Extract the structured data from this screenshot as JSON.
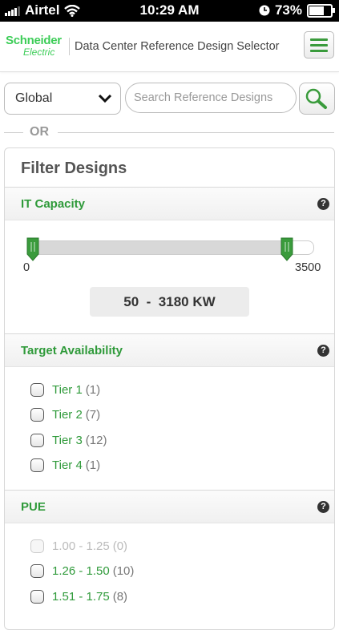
{
  "status": {
    "carrier": "Airtel",
    "time": "10:29 AM",
    "battery": "73%",
    "battery_level": 0.73
  },
  "header": {
    "logo_line1": "Schneider",
    "logo_line2": "Electric",
    "title": "Data Center Reference Design Selector",
    "menu_icon": "hamburger-icon"
  },
  "search": {
    "region": "Global",
    "placeholder": "Search Reference Designs",
    "search_icon": "magnifier-icon"
  },
  "or_label": "OR",
  "filter": {
    "title": "Filter Designs",
    "it_capacity": {
      "label": "IT Capacity",
      "help": "?",
      "min_label": "0",
      "max_label": "3500",
      "range_min": 0,
      "range_max": 3500,
      "low": 50,
      "high": 3180,
      "low_text": "50",
      "separator": "-",
      "high_text": "3180",
      "unit": "KW"
    },
    "target_availability": {
      "label": "Target Availability",
      "help": "?",
      "options": [
        {
          "label": "Tier 1",
          "count": "(1)"
        },
        {
          "label": "Tier 2",
          "count": "(7)"
        },
        {
          "label": "Tier 3",
          "count": "(12)"
        },
        {
          "label": "Tier 4",
          "count": "(1)"
        }
      ]
    },
    "pue": {
      "label": "PUE",
      "help": "?",
      "options": [
        {
          "label": "1.00 - 1.25",
          "count": "(0)",
          "disabled": true
        },
        {
          "label": "1.26 - 1.50",
          "count": "(10)"
        },
        {
          "label": "1.51 - 1.75",
          "count": "(8)"
        }
      ]
    }
  },
  "colors": {
    "brand_green": "#3dcd58",
    "link_green": "#2f9a3a"
  }
}
